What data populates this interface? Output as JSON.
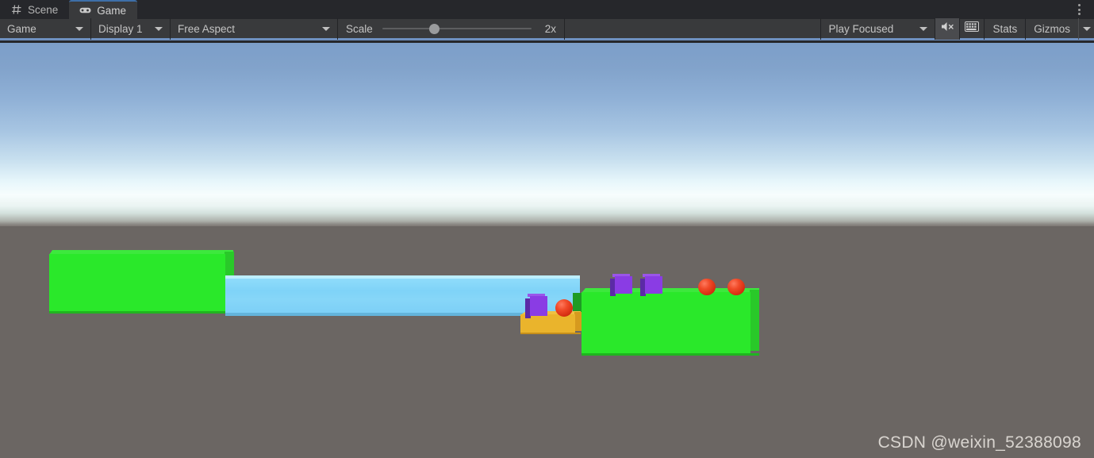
{
  "window": {
    "tabs": [
      {
        "label": "Scene",
        "icon": "grid-hash-icon",
        "active": false
      },
      {
        "label": "Game",
        "icon": "gamepad-icon",
        "active": true
      }
    ],
    "overflow_menu": "more-options-icon"
  },
  "toolbar": {
    "game_dropdown": "Game",
    "display_dropdown": "Display 1",
    "aspect_dropdown": "Free Aspect",
    "scale_label": "Scale",
    "scale_value": "2x",
    "scale_slider_percent": 35,
    "play_mode_dropdown": "Play Focused",
    "mute_audio_icon": "mute-audio-icon",
    "stats_grid_icon": "keyboard-grid-icon",
    "stats_button": "Stats",
    "gizmos_button": "Gizmos",
    "gizmos_caret": "chevron-down-icon"
  },
  "gameview": {
    "watermark": "CSDN @weixin_52388098",
    "colors": {
      "sky_top": "#7c9ec9",
      "sky_horizon": "#f7fdfd",
      "ground": "#6b6663",
      "platform_green": "#2ae82a",
      "platform_green_top": "#3de83d",
      "platform_green_side": "#29c929",
      "water": "#7fd3f8",
      "water_top": "#bdeefd",
      "platform_orange": "#eab42c",
      "cube_purple": "#8a3ce4",
      "cube_purple_dark": "#5b2aa6",
      "sphere_red": "#f04a28"
    },
    "objects": [
      {
        "name": "left-green-platform",
        "type": "platform",
        "color": "#2ae82a"
      },
      {
        "name": "water-pool",
        "type": "water",
        "color": "#7fd3f8"
      },
      {
        "name": "orange-platform",
        "type": "platform",
        "color": "#eab42c"
      },
      {
        "name": "right-green-platform",
        "type": "platform",
        "color": "#2ae82a"
      },
      {
        "name": "purple-cube-1",
        "type": "cube",
        "color": "#8a3ce4"
      },
      {
        "name": "purple-cube-2",
        "type": "cube",
        "color": "#8a3ce4"
      },
      {
        "name": "purple-cube-3",
        "type": "cube",
        "color": "#8a3ce4"
      },
      {
        "name": "red-sphere-1",
        "type": "sphere",
        "color": "#f04a28"
      },
      {
        "name": "red-sphere-2",
        "type": "sphere",
        "color": "#f04a28"
      },
      {
        "name": "red-sphere-3",
        "type": "sphere",
        "color": "#f04a28"
      }
    ]
  }
}
